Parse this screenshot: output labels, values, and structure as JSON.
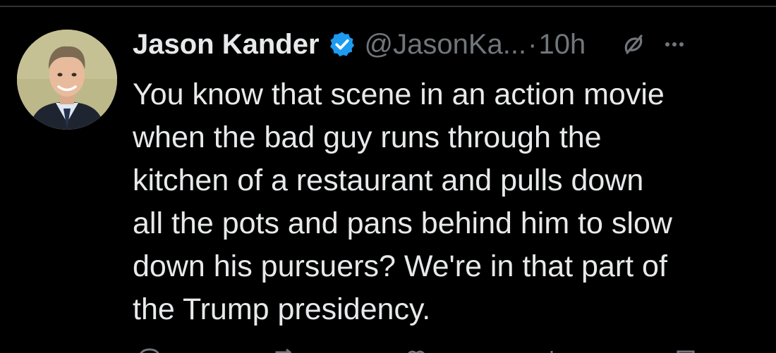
{
  "tweet": {
    "author": {
      "display_name": "Jason Kander",
      "handle": "@JasonKa...",
      "verified": true
    },
    "separator": "·",
    "time": "10h",
    "text_lines": [
      "You know that scene in an action movie",
      "when the bad guy runs through the",
      "kitchen of a restaurant and pulls down",
      "all the pots and pans behind him to slow",
      "down his pursuers? We're in that part of",
      "the Trump presidency."
    ]
  },
  "icons": {
    "verified": "verified-badge-icon",
    "grok": "grok-icon",
    "more": "more-options-icon",
    "reply": "reply-icon",
    "repost": "repost-icon",
    "like": "like-icon",
    "views": "views-icon",
    "bookmark": "bookmark-icon"
  },
  "colors": {
    "background": "#000000",
    "text_primary": "#e7e9ea",
    "text_secondary": "#71767b",
    "verified_blue": "#1d9bf0",
    "divider": "#2f3336"
  }
}
